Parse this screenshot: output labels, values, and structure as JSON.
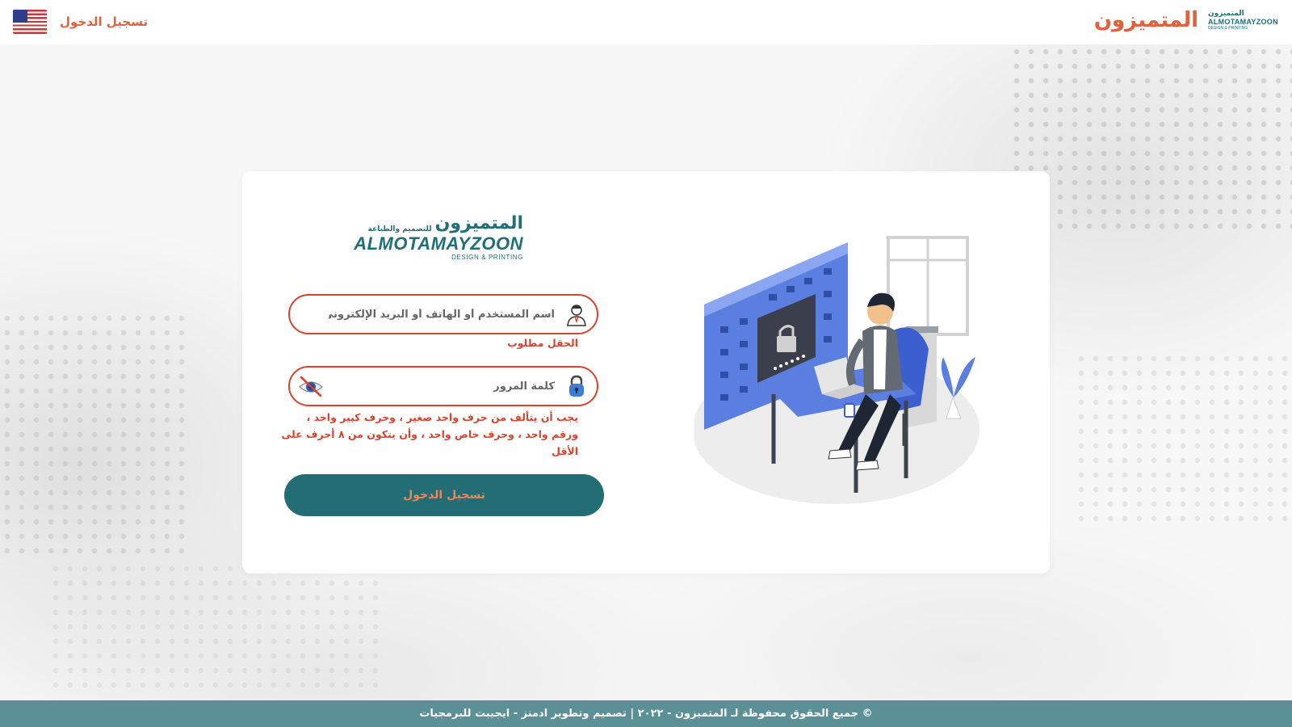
{
  "header": {
    "brand_title": "المتميزون",
    "brand_mini_ar": "المتميزون",
    "brand_mini_en": "ALMOTAMAYZOON",
    "brand_mini_tag": "DESIGN & PRINTING",
    "login_link": "تسجيل الدخول",
    "language_flag_icon": "us-flag-icon"
  },
  "card": {
    "logo": {
      "ar_main": "المتميزون",
      "ar_sub": "للتصميم والطباعة",
      "en_main": "ALMOTAMAYZOON",
      "en_sub": "DESIGN & PRINTING"
    },
    "username": {
      "placeholder": "اسم المستخدم أو الهاتف أو البريد الإلكتروني",
      "value": "",
      "icon": "user-icon",
      "error": "الحقل مطلوب"
    },
    "password": {
      "placeholder": "كلمة المرور",
      "value": "",
      "icon": "lock-icon",
      "toggle_icon": "eye-slash-icon",
      "error_line1": "يجب أن يتألف من حرف واحد صغير ، وحرف كبير واحد ،",
      "error_line2": "ورقم واحد ، وحرف خاص واحد ، وأن يتكون من ٨ أحرف على",
      "error_line3": "الأقل"
    },
    "submit_label": "تسجيل الدخول",
    "illustration_icon": "person-at-computer-login-illustration"
  },
  "footer": {
    "text": "© جميع الحقوق محفوظة لـ المتميزون - ٢٠٢٢ | تصميم وتطوير ادمنز - ايجيبت للبرمجيات"
  },
  "colors": {
    "accent": "#e2613d",
    "error": "#d9432e",
    "primary": "#236d75",
    "footer_bg": "#5b9196"
  }
}
